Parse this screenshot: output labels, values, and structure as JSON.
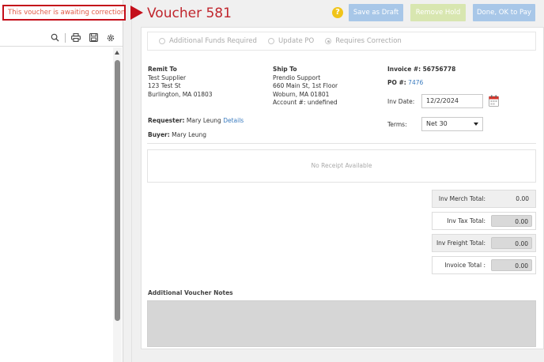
{
  "alert": {
    "text": "This voucher is awaiting correction"
  },
  "viewer": {
    "toolbar": [
      "search-icon",
      "print-icon",
      "save-icon",
      "settings-icon"
    ]
  },
  "header": {
    "title": "Voucher 581",
    "help_icon": "?",
    "buttons": {
      "save_draft": "Save as Draft",
      "remove_hold": "Remove Hold",
      "done_pay": "Done, OK to Pay"
    }
  },
  "status_options": [
    {
      "label": "Additional Funds Required",
      "selected": false
    },
    {
      "label": "Update PO",
      "selected": false
    },
    {
      "label": "Requires Correction",
      "selected": true
    }
  ],
  "remit_to": {
    "heading": "Remit To",
    "lines": [
      "Test Supplier",
      "123 Test St",
      "Burlington, MA 01803"
    ]
  },
  "ship_to": {
    "heading": "Ship To",
    "lines": [
      "Prendio Support",
      "660 Main St, 1st Floor",
      "Woburn, MA 01801",
      "Account #: undefined"
    ]
  },
  "requester": {
    "label": "Requester:",
    "name": "Mary Leung",
    "details_link": "Details"
  },
  "buyer": {
    "label": "Buyer:",
    "name": "Mary Leung"
  },
  "invoice": {
    "number_label": "Invoice #:",
    "number": "56756778",
    "po_label": "PO #:",
    "po_number": "7476",
    "date_label": "Inv Date:",
    "date_value": "12/2/2024",
    "terms_label": "Terms:",
    "terms_value": "Net 30"
  },
  "receipt": {
    "empty_text": "No Receipt Available"
  },
  "totals": [
    {
      "label": "Inv Merch Total:",
      "value": "0.00"
    },
    {
      "label": "Inv Tax Total:",
      "value": "0.00"
    },
    {
      "label": "Inv Freight Total:",
      "value": "0.00"
    },
    {
      "label": "Invoice Total :",
      "value": "0.00"
    }
  ],
  "notes": {
    "label": "Additional Voucher Notes",
    "value": ""
  },
  "colors": {
    "alert_border": "#c40e1a",
    "title": "#c0262d",
    "primary_button": "#a8c7e8",
    "hold_button": "#d8e6b0",
    "help": "#f0c419",
    "link": "#3a7bbf"
  }
}
